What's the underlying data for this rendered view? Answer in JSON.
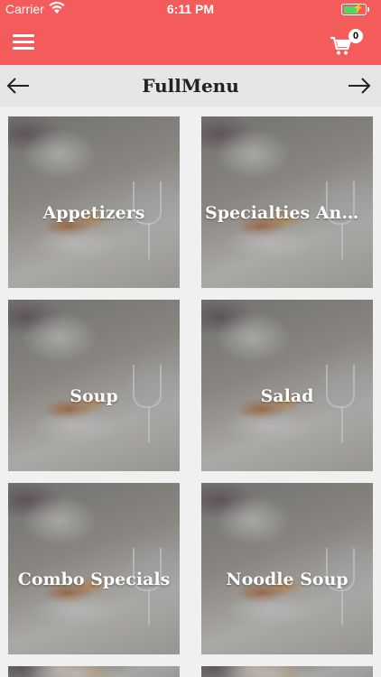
{
  "status_bar": {
    "carrier": "Carrier",
    "time": "6:11 PM"
  },
  "header": {
    "cart_count": "0"
  },
  "title_bar": {
    "title": "FullMenu"
  },
  "menu_tiles": [
    {
      "label": "Appetizers"
    },
    {
      "label": "Specialties And S..."
    },
    {
      "label": "Soup"
    },
    {
      "label": "Salad"
    },
    {
      "label": "Combo Specials"
    },
    {
      "label": "Noodle Soup"
    }
  ],
  "colors": {
    "header": "#f45b5b",
    "titlebar": "#e6e6e6",
    "background": "#f0f0f0"
  },
  "icons": [
    "menu-icon",
    "cart-icon",
    "back-arrow-icon",
    "forward-arrow-icon",
    "wifi-icon",
    "battery-icon"
  ]
}
